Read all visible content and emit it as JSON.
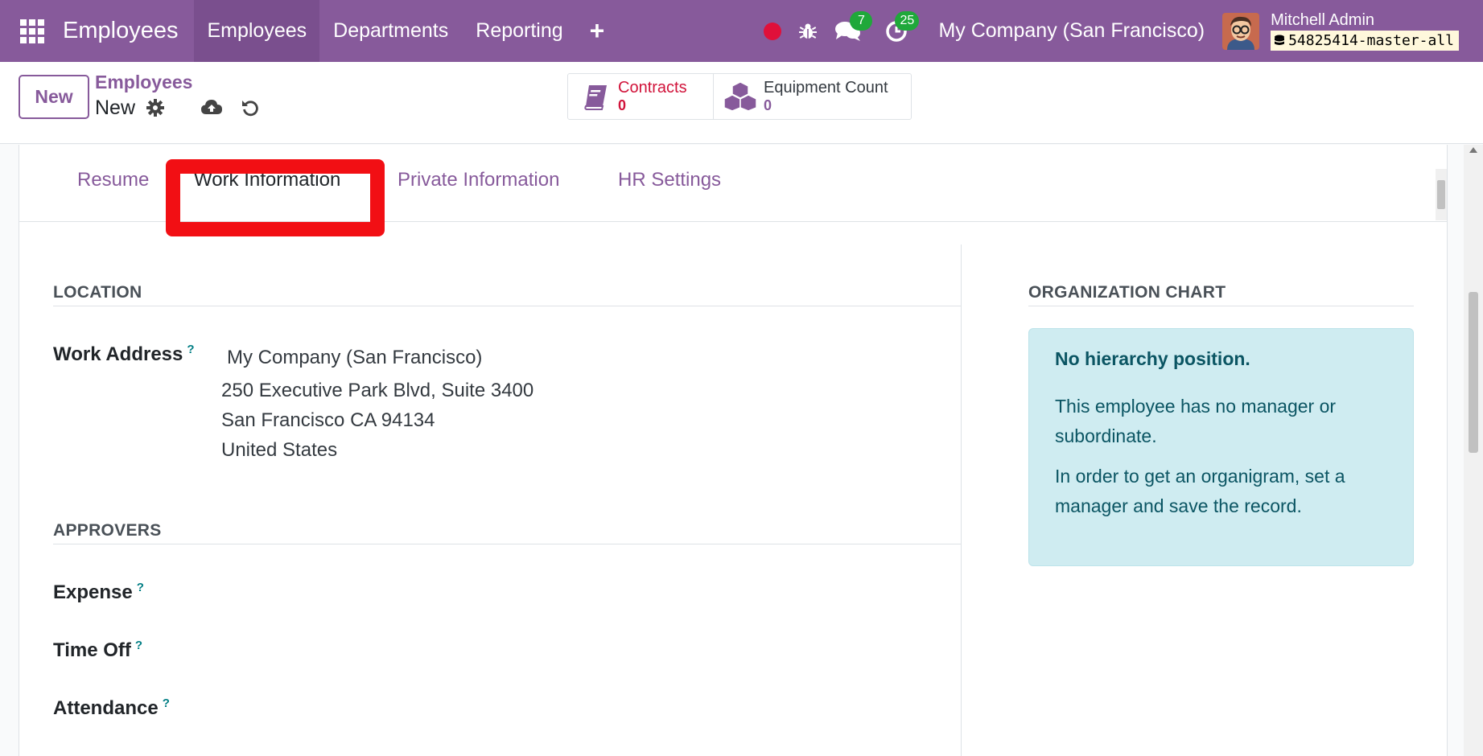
{
  "navbar": {
    "app_name": "Employees",
    "menu": [
      "Employees",
      "Departments",
      "Reporting"
    ],
    "plus": "+",
    "chat_badge": "7",
    "activity_badge": "25",
    "company": "My Company (San Francisco)",
    "user_name": "Mitchell Admin",
    "db_name": "54825414-master-all"
  },
  "control": {
    "new_button": "New",
    "breadcrumb_parent": "Employees",
    "breadcrumb_current": "New",
    "stats": [
      {
        "label": "Contracts",
        "value": "0",
        "color": "#d1133a"
      },
      {
        "label": "Equipment Count",
        "value": "0",
        "color": "#875a9b"
      }
    ]
  },
  "tabs": {
    "items": [
      "Resume",
      "Work Information",
      "Private Information",
      "HR Settings"
    ],
    "active": "Work Information"
  },
  "location": {
    "title": "LOCATION",
    "work_address_label": "Work Address",
    "help": "?",
    "address_lines": [
      "My Company (San Francisco)",
      "250 Executive Park Blvd, Suite 3400",
      "San Francisco CA 94134",
      "United States"
    ]
  },
  "approvers": {
    "title": "APPROVERS",
    "fields": [
      "Expense",
      "Time Off",
      "Attendance"
    ]
  },
  "org_chart": {
    "title": "ORGANIZATION CHART",
    "alert_title": "No hierarchy position.",
    "alert_p1": "This employee has no manager or subordinate.",
    "alert_p2": "In order to get an organigram, set a manager and save the record."
  },
  "colors": {
    "brand": "#875a9b",
    "highlight": "#f20f14",
    "alert_bg": "#cfecf1",
    "badge": "#1fa83a"
  }
}
